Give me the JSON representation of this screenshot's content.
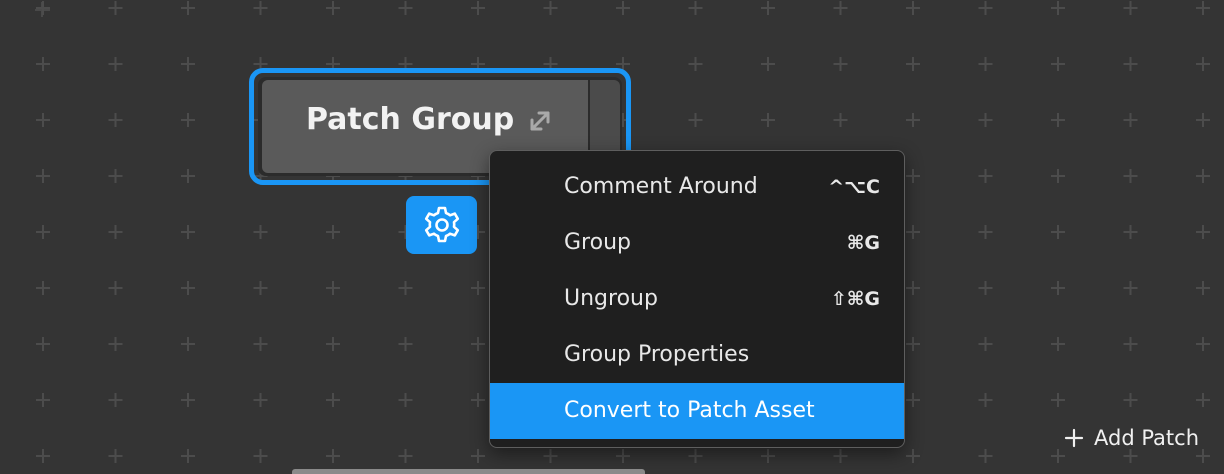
{
  "canvas": {
    "background_color": "#343434",
    "grid_marker": "plus-icon"
  },
  "node": {
    "title": "Patch Group",
    "expand_icon": "expand-arrows-icon",
    "selection_color": "#1a96f5",
    "settings_icon": "gear-icon"
  },
  "context_menu": {
    "items": [
      {
        "label": "Comment Around",
        "shortcut": "^⌥C",
        "highlighted": false
      },
      {
        "label": "Group",
        "shortcut": "⌘G",
        "highlighted": false
      },
      {
        "label": "Ungroup",
        "shortcut": "⇧⌘G",
        "highlighted": false
      },
      {
        "label": "Group Properties",
        "shortcut": "",
        "highlighted": false
      },
      {
        "label": "Convert to Patch Asset",
        "shortcut": "",
        "highlighted": true
      }
    ],
    "highlight_color": "#1a96f5"
  },
  "add_patch": {
    "label": "Add Patch",
    "icon": "plus-icon"
  }
}
